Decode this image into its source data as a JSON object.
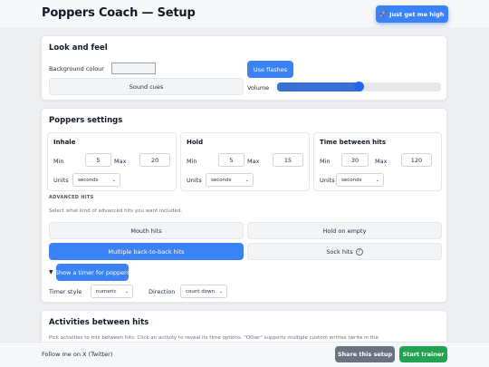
{
  "header": {
    "title": "Poppers Coach — Setup",
    "high_button": "Just get me high"
  },
  "look_and_feel": {
    "title": "Look and feel",
    "background_colour_label": "Background colour",
    "use_flashes_label": "Use flashes",
    "sound_cues_label": "Sound cues",
    "volume_label": "Volume",
    "volume_level_fraction": 0.5
  },
  "poppers_settings": {
    "title": "Poppers settings",
    "min_label": "Min",
    "max_label": "Max",
    "units_label": "Units",
    "panels": [
      {
        "title": "Inhale",
        "min": "5",
        "max": "20",
        "units": "seconds"
      },
      {
        "title": "Hold",
        "min": "5",
        "max": "15",
        "units": "seconds"
      },
      {
        "title": "Time between hits",
        "min": "30",
        "max": "120",
        "units": "seconds"
      }
    ],
    "advanced_heading": "ADVANCED HITS",
    "advanced_desc": "Select what kind of advanced hits you want included.",
    "advanced_options": [
      "Mouth hits",
      "Hold on empty",
      "Multiple back-to-back hits",
      "Sock hits"
    ],
    "sock_help_icon": "?",
    "timer_toggle_arrow": "▼",
    "timer_button": "Show a timer for poppers",
    "timer_style_label": "Timer style",
    "timer_style_value": "numeric",
    "direction_label": "Direction",
    "direction_value": "count down"
  },
  "activities": {
    "title": "Activities between hits",
    "desc": "Pick activities to mix between hits. Click an activity to reveal its time options. \"Other\" supports multiple custom entries (write in the"
  },
  "footer": {
    "follow_text": "Follow me on X (Twitter)",
    "share_button": "Share this setup",
    "start_button": "Start trainer"
  },
  "colors": {
    "accent": "#3b82f6",
    "start": "#22a352",
    "share": "#6b7280"
  }
}
